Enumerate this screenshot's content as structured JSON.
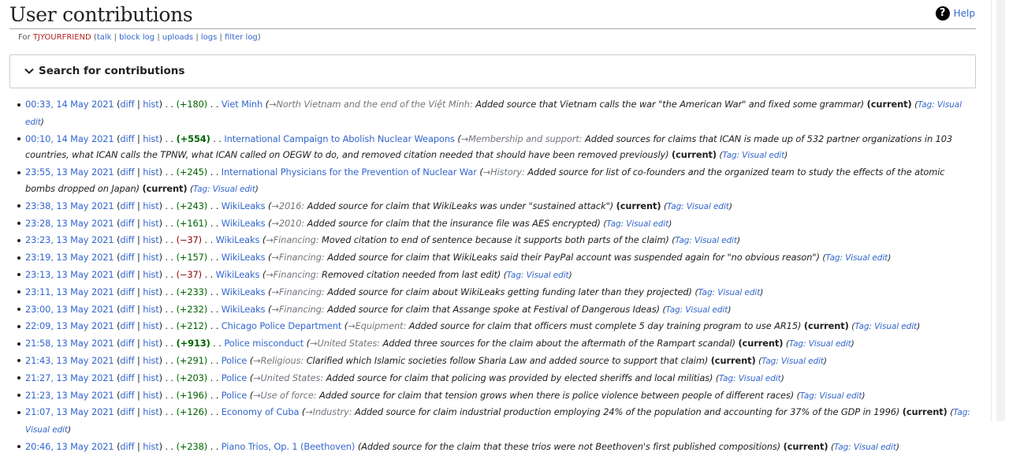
{
  "page": {
    "title": "User contributions",
    "help": "Help",
    "for_prefix": "For ",
    "user": "TJYOURFRIEND",
    "tools": [
      "talk",
      "block log",
      "uploads",
      "logs",
      "filter log"
    ],
    "search_label": "Search for contributions"
  },
  "entries": [
    {
      "time": "00:33, 14 May 2021",
      "diff": "diff",
      "hist": "hist",
      "delta": "(+180)",
      "sign": "pos",
      "big": false,
      "page": "Viet Minh",
      "page_red": false,
      "section": "→North Vietnam and the end of the Việt Minh:",
      "summary": " Added source that Vietnam calls the war \"the American War\" and fixed some grammar)",
      "current": "(current)",
      "tag": "Tag:",
      "tag_name": "Visual edit"
    },
    {
      "time": "00:10, 14 May 2021",
      "diff": "diff",
      "hist": "hist",
      "delta": "(+554)",
      "sign": "pos",
      "big": true,
      "page": "International Campaign to Abolish Nuclear Weapons",
      "page_red": false,
      "section": "→Membership and support:",
      "summary": " Added sources for claims that ICAN is made up of 532 partner organizations in 103 countries, what ICAN calls the TPNW, what ICAN called on OEGW to do, and removed citation needed that should have been removed previously)",
      "current": "(current)",
      "tag": "Tag:",
      "tag_name": "Visual edit"
    },
    {
      "time": "23:55, 13 May 2021",
      "diff": "diff",
      "hist": "hist",
      "delta": "(+245)",
      "sign": "pos",
      "big": false,
      "page": "International Physicians for the Prevention of Nuclear War",
      "page_red": false,
      "section": "→History:",
      "summary": " Added source for list of co-founders and the organized team to study the effects of the atomic bombs dropped on Japan)",
      "current": "(current)",
      "tag": "Tag:",
      "tag_name": "Visual edit"
    },
    {
      "time": "23:38, 13 May 2021",
      "diff": "diff",
      "hist": "hist",
      "delta": "(+243)",
      "sign": "pos",
      "big": false,
      "page": "WikiLeaks",
      "page_red": false,
      "section": "→2016:",
      "summary": " Added source for claim that WikiLeaks was under \"sustained attack\")",
      "current": "(current)",
      "tag": "Tag:",
      "tag_name": "Visual edit"
    },
    {
      "time": "23:28, 13 May 2021",
      "diff": "diff",
      "hist": "hist",
      "delta": "(+161)",
      "sign": "pos",
      "big": false,
      "page": "WikiLeaks",
      "page_red": false,
      "section": "→2010:",
      "summary": " Added source for claim that the insurance file was AES encrypted)",
      "current": "",
      "tag": "Tag:",
      "tag_name": "Visual edit"
    },
    {
      "time": "23:23, 13 May 2021",
      "diff": "diff",
      "hist": "hist",
      "delta": "(−37)",
      "sign": "neg",
      "big": false,
      "page": "WikiLeaks",
      "page_red": false,
      "section": "→Financing:",
      "summary": " Moved citation to end of sentence because it supports both parts of the claim)",
      "current": "",
      "tag": "Tag:",
      "tag_name": "Visual edit"
    },
    {
      "time": "23:19, 13 May 2021",
      "diff": "diff",
      "hist": "hist",
      "delta": "(+157)",
      "sign": "pos",
      "big": false,
      "page": "WikiLeaks",
      "page_red": false,
      "section": "→Financing:",
      "summary": " Added source for claim that WikiLeaks said their PayPal account was suspended again for \"no obvious reason\")",
      "current": "",
      "tag": "Tag:",
      "tag_name": "Visual edit"
    },
    {
      "time": "23:13, 13 May 2021",
      "diff": "diff",
      "hist": "hist",
      "delta": "(−37)",
      "sign": "neg",
      "big": false,
      "page": "WikiLeaks",
      "page_red": false,
      "section": "→Financing:",
      "summary": " Removed citation needed from last edit)",
      "current": "",
      "tag": "Tag:",
      "tag_name": "Visual edit"
    },
    {
      "time": "23:11, 13 May 2021",
      "diff": "diff",
      "hist": "hist",
      "delta": "(+233)",
      "sign": "pos",
      "big": false,
      "page": "WikiLeaks",
      "page_red": false,
      "section": "→Financing:",
      "summary": " Added source for claim about WikiLeaks getting funding later than they projected)",
      "current": "",
      "tag": "Tag:",
      "tag_name": "Visual edit"
    },
    {
      "time": "23:00, 13 May 2021",
      "diff": "diff",
      "hist": "hist",
      "delta": "(+232)",
      "sign": "pos",
      "big": false,
      "page": "WikiLeaks",
      "page_red": false,
      "section": "→Financing:",
      "summary": " Added source for claim that Assange spoke at Festival of Dangerous Ideas)",
      "current": "",
      "tag": "Tag:",
      "tag_name": "Visual edit"
    },
    {
      "time": "22:09, 13 May 2021",
      "diff": "diff",
      "hist": "hist",
      "delta": "(+212)",
      "sign": "pos",
      "big": false,
      "page": "Chicago Police Department",
      "page_red": false,
      "section": "→Equipment:",
      "summary": " Added source for claim that officers must complete 5 day training program to use AR15)",
      "current": "(current)",
      "tag": "Tag:",
      "tag_name": "Visual edit"
    },
    {
      "time": "21:58, 13 May 2021",
      "diff": "diff",
      "hist": "hist",
      "delta": "(+913)",
      "sign": "pos",
      "big": true,
      "page": "Police misconduct",
      "page_red": false,
      "section": "→United States:",
      "summary": " Added three sources for the claim about the aftermath of the Rampart scandal)",
      "current": "(current)",
      "tag": "Tag:",
      "tag_name": "Visual edit"
    },
    {
      "time": "21:43, 13 May 2021",
      "diff": "diff",
      "hist": "hist",
      "delta": "(+291)",
      "sign": "pos",
      "big": false,
      "page": "Police",
      "page_red": false,
      "section": "→Religious:",
      "summary": " Clarified which Islamic societies follow Sharia Law and added source to support that claim)",
      "current": "(current)",
      "tag": "Tag:",
      "tag_name": "Visual edit"
    },
    {
      "time": "21:27, 13 May 2021",
      "diff": "diff",
      "hist": "hist",
      "delta": "(+203)",
      "sign": "pos",
      "big": false,
      "page": "Police",
      "page_red": false,
      "section": "→United States:",
      "summary": " Added source for claim that policing was provided by elected sheriffs and local militias)",
      "current": "",
      "tag": "Tag:",
      "tag_name": "Visual edit"
    },
    {
      "time": "21:23, 13 May 2021",
      "diff": "diff",
      "hist": "hist",
      "delta": "(+196)",
      "sign": "pos",
      "big": false,
      "page": "Police",
      "page_red": false,
      "section": "→Use of force:",
      "summary": " Added source for claim that tension grows when there is police violence between people of different races)",
      "current": "",
      "tag": "Tag:",
      "tag_name": "Visual edit"
    },
    {
      "time": "21:07, 13 May 2021",
      "diff": "diff",
      "hist": "hist",
      "delta": "(+126)",
      "sign": "pos",
      "big": false,
      "page": "Economy of Cuba",
      "page_red": false,
      "section": "→Industry:",
      "summary": " Added source for claim industrial production employing 24% of the population and accounting for 37% of the GDP in 1996)",
      "current": "(current)",
      "tag": "Tag:",
      "tag_name": "Visual edit"
    },
    {
      "time": "20:46, 13 May 2021",
      "diff": "diff",
      "hist": "hist",
      "delta": "(+238)",
      "sign": "pos",
      "big": false,
      "page": "Piano Trios, Op. 1 (Beethoven)",
      "page_red": false,
      "section": "",
      "summary": "Added source for the claim that these trios were not Beethoven's first published compositions)",
      "current": "(current)",
      "tag": "Tag:",
      "tag_name": "Visual edit"
    }
  ]
}
